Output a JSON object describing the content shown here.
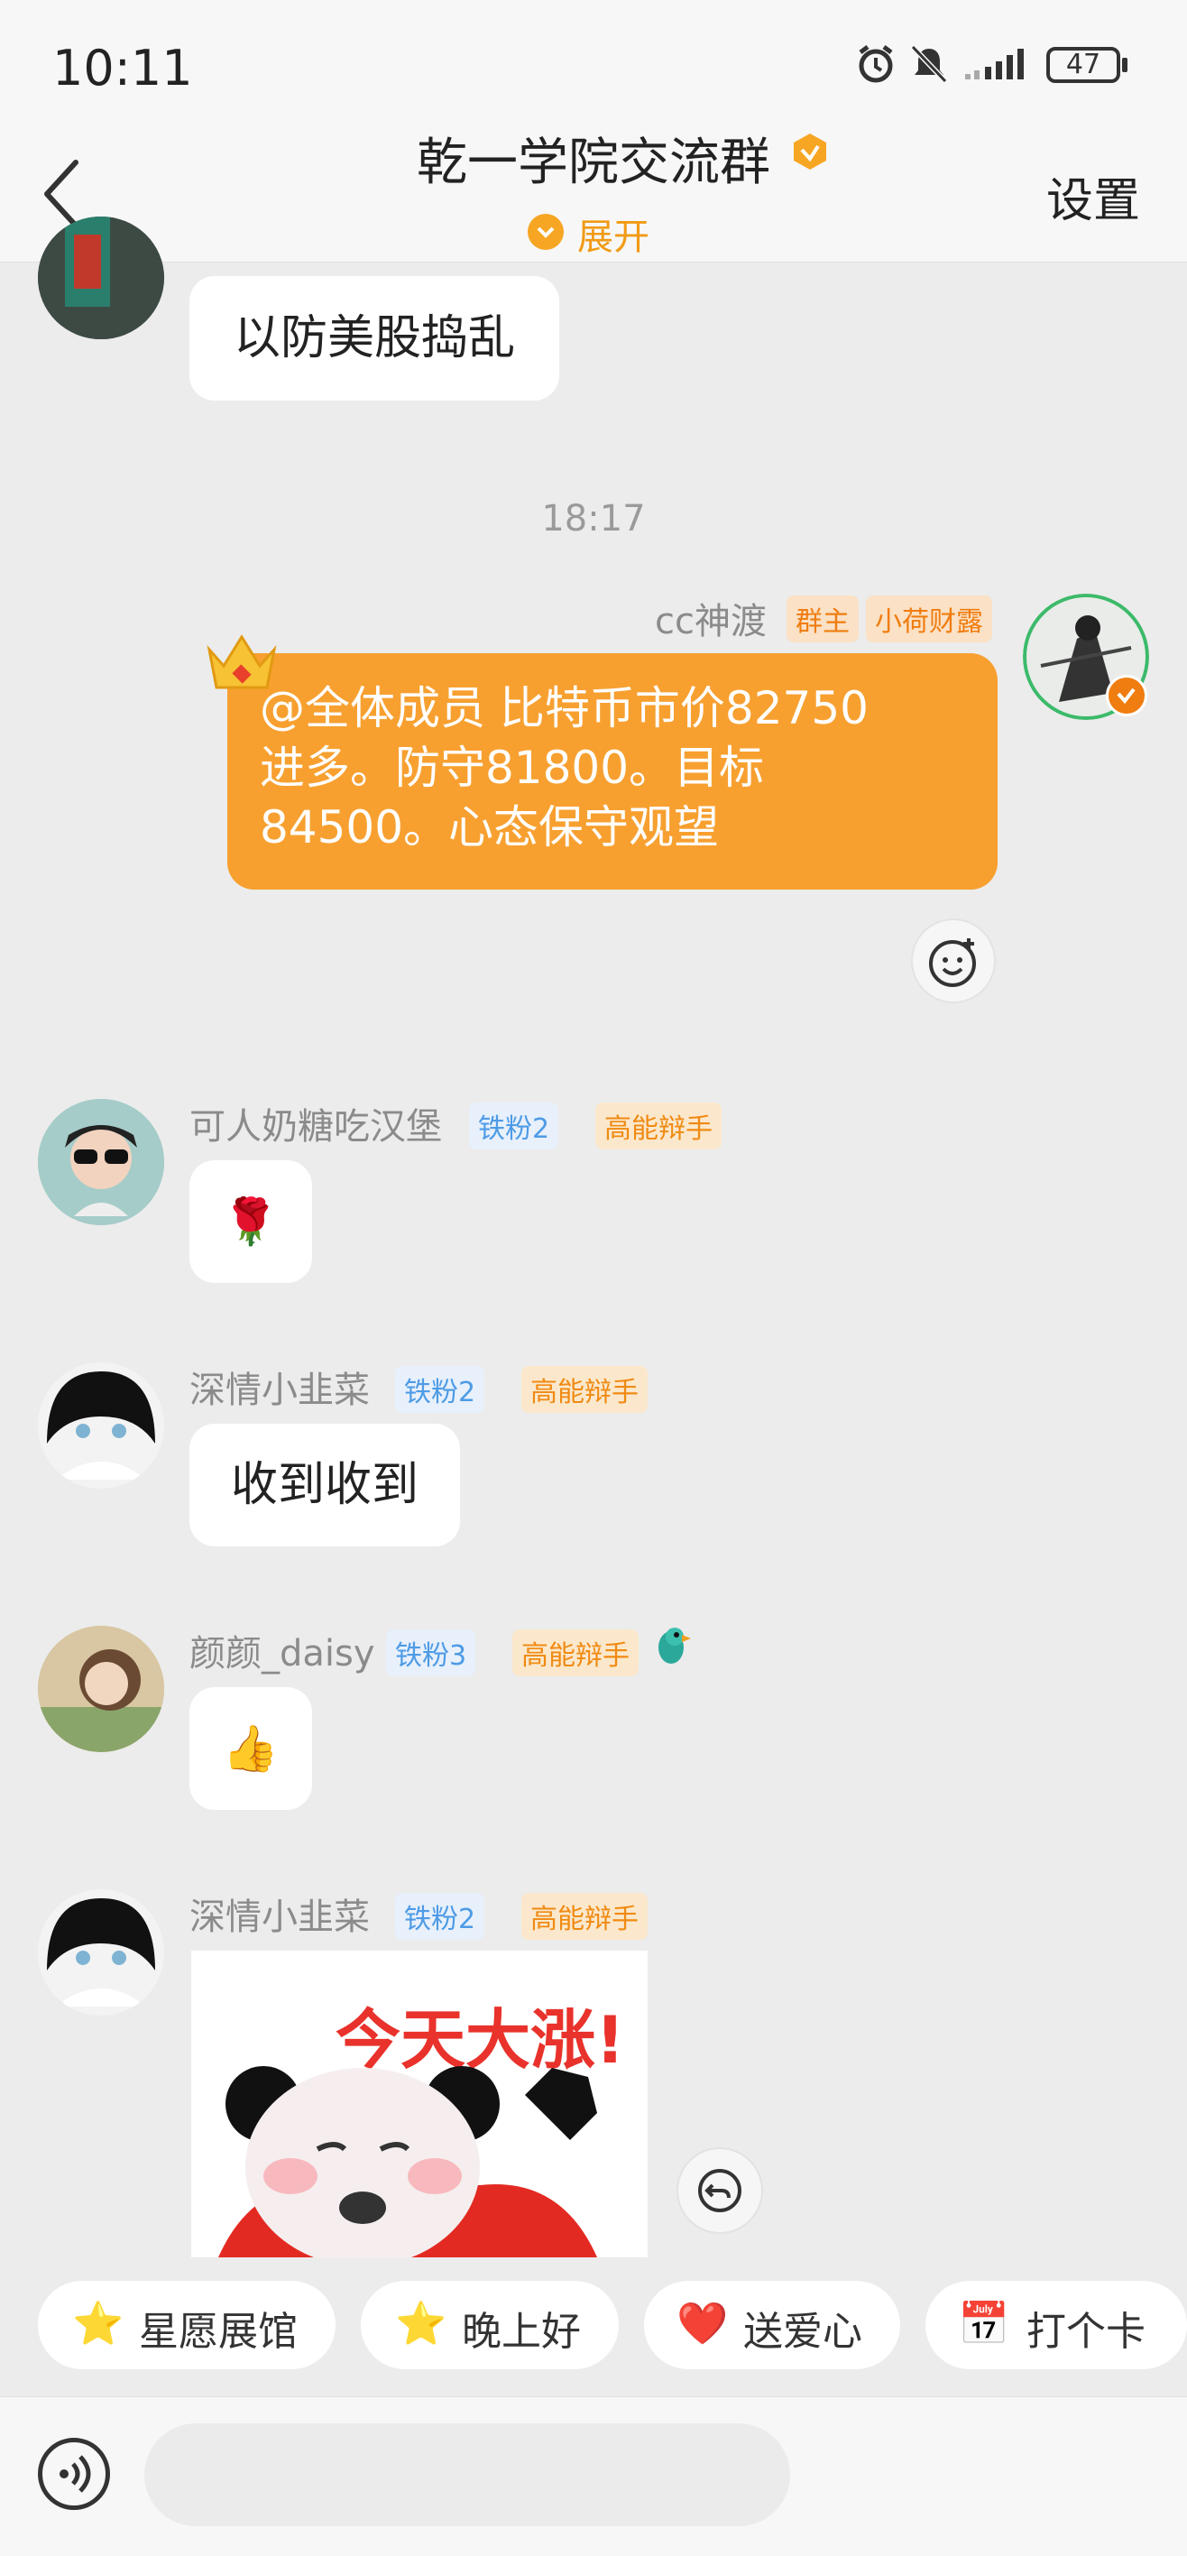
{
  "status_bar": {
    "time": "10:11",
    "battery": "47"
  },
  "header": {
    "title": "乾一学院交流群",
    "expand_label": "展开",
    "settings_label": "设置"
  },
  "messages": [
    {
      "type": "text",
      "text": "以防美股捣乱"
    },
    {
      "type": "timestamp",
      "text": "18:17"
    },
    {
      "type": "text",
      "self": true,
      "nickname": "cc神渡",
      "badges": [
        "群主",
        "小荷财露"
      ],
      "text_line1": "@全体成员 比特币市价82750",
      "text_line2": "进多。防守81800。目标",
      "text_line3": "84500。心态保守观望"
    },
    {
      "type": "emoji",
      "nickname": "可人奶糖吃汉堡",
      "badges": [
        "铁粉2",
        "高能辩手"
      ],
      "emoji": "🌹"
    },
    {
      "type": "text",
      "nickname": "深情小韭菜",
      "badges": [
        "铁粉2",
        "高能辩手"
      ],
      "text": "收到收到"
    },
    {
      "type": "emoji",
      "nickname": "颜颜_daisy",
      "badges": [
        "铁粉3",
        "高能辩手"
      ],
      "emoji": "👍"
    },
    {
      "type": "sticker",
      "nickname": "深情小韭菜",
      "badges": [
        "铁粉2",
        "高能辩手"
      ],
      "sticker_text": "今天大涨!"
    }
  ],
  "quick_replies": [
    {
      "icon": "⭐",
      "label": "星愿展馆"
    },
    {
      "icon": "⭐",
      "label": "晚上好"
    },
    {
      "icon": "❤️",
      "label": "送爱心"
    },
    {
      "icon": "📅",
      "label": "打个卡"
    }
  ],
  "input": {
    "placeholder": ""
  },
  "colors": {
    "accent": "#f7a030",
    "background": "#ececec",
    "fan_badge": "#4e9be6",
    "talk_badge": "#f08a12"
  }
}
